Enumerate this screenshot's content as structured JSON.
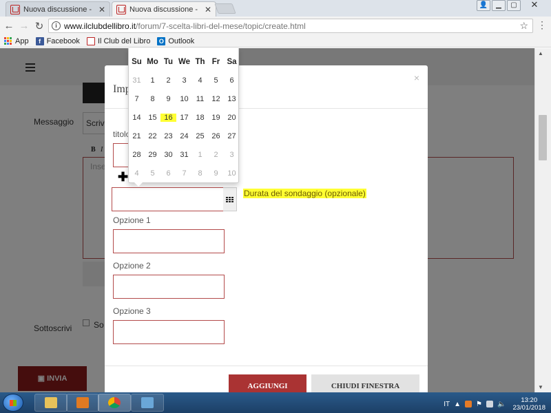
{
  "browser": {
    "tabs": [
      {
        "title": "Nuova discussione - Il Cl",
        "active": false
      },
      {
        "title": "Nuova discussione - Il Cl",
        "active": true
      }
    ],
    "url_host": "www.ilclubdellibro.it",
    "url_path": "/forum/7-scelta-libri-del-mese/topic/create.html",
    "bookmarks": [
      "App",
      "Facebook",
      "Il Club del Libro",
      "Outlook"
    ]
  },
  "page": {
    "labels": {
      "messaggio": "Messaggio",
      "sottoscrivi": "Sottoscrivi"
    },
    "editor_toolbar": [
      "B",
      "I"
    ],
    "fragments": {
      "scrivi": "Scrivi",
      "editor_placeholder": "Inse",
      "subscribe_checkbox": "So"
    },
    "submit_label": "INVIA"
  },
  "modal": {
    "title": "Imp",
    "close": "×",
    "field_titolo_label": "titolo",
    "duration_label": "Durata del sondaggio (opzionale)",
    "options": [
      "Opzione 1",
      "Opzione 2",
      "Opzione 3"
    ],
    "add_button": "AGGIUNGI",
    "close_button": "CHIUDI FINESTRA"
  },
  "datepicker": {
    "weekdays": [
      "Su",
      "Mo",
      "Tu",
      "We",
      "Th",
      "Fr",
      "Sa"
    ],
    "weeks": [
      [
        "31",
        "1",
        "2",
        "3",
        "4",
        "5",
        "6"
      ],
      [
        "7",
        "8",
        "9",
        "10",
        "11",
        "12",
        "13"
      ],
      [
        "14",
        "15",
        "16",
        "17",
        "18",
        "19",
        "20"
      ],
      [
        "21",
        "22",
        "23",
        "24",
        "25",
        "26",
        "27"
      ],
      [
        "28",
        "29",
        "30",
        "31",
        "1",
        "2",
        "3"
      ],
      [
        "4",
        "5",
        "6",
        "7",
        "8",
        "9",
        "10"
      ]
    ],
    "today": "16"
  },
  "taskbar": {
    "language": "IT",
    "time": "13:20",
    "date": "23/01/2018"
  },
  "colors": {
    "accent": "#aa3333",
    "highlight": "#ffff33",
    "border_red": "#b34a4a"
  }
}
